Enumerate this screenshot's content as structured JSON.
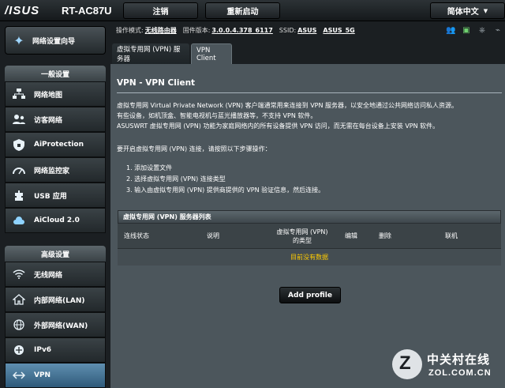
{
  "header": {
    "logo": "/ISUS",
    "model": "RT-AC87U",
    "logout_label": "注销",
    "reboot_label": "重新启动",
    "language": "简体中文"
  },
  "sidebar": {
    "quick_setup": "网络设置向导",
    "general_title": "一般设置",
    "general_items": [
      {
        "label": "网络地图",
        "icon": "network-map-icon"
      },
      {
        "label": "访客网络",
        "icon": "guest-network-icon"
      },
      {
        "label": "AiProtection",
        "icon": "aiprotection-icon"
      },
      {
        "label": "网络监控家",
        "icon": "traffic-monitor-icon"
      },
      {
        "label": "USB 应用",
        "icon": "usb-app-icon"
      },
      {
        "label": "AiCloud 2.0",
        "icon": "aicloud-icon"
      }
    ],
    "advanced_title": "高级设置",
    "advanced_items": [
      {
        "label": "无线网络",
        "icon": "wireless-icon"
      },
      {
        "label": "内部网络(LAN)",
        "icon": "lan-icon"
      },
      {
        "label": "外部网络(WAN)",
        "icon": "wan-icon"
      },
      {
        "label": "IPv6",
        "icon": "ipv6-icon"
      },
      {
        "label": "VPN",
        "icon": "vpn-icon",
        "active": true
      }
    ]
  },
  "status": {
    "mode_key": "操作模式:",
    "mode_value": "无线路由器",
    "firmware_key": "固件版本:",
    "firmware_value": "3.0.0.4.378_6117",
    "ssid_key": "SSID:",
    "ssid_1": "ASUS",
    "ssid_2": "ASUS_5G"
  },
  "tabs": {
    "server": "虚拟专用网 (VPN) 服务器",
    "client": "VPN Client"
  },
  "panel": {
    "title": "VPN - VPN Client",
    "desc_line1": "虚拟专用网 Virtual Private Network (VPN) 客户端通常用来连接到 VPN 服务器，以安全地通过公共网络访问私人资源。",
    "desc_line2": "有些设备，如机顶盒、智能电视机与蓝光播放器等，不支持 VPN 软件。",
    "desc_line3": "ASUSWRT 虚拟专用网 (VPN) 功能为家庭网络内的所有设备提供 VPN 访问，而无需在每台设备上安装 VPN 软件。",
    "steps_intro": "要开启虚拟专用网 (VPN) 连接，请按照以下步骤操作：",
    "step1": "1.  添加设置文件",
    "step2": "2.  选择虚拟专用网 (VPN) 连接类型",
    "step3": "3.  输入由虚拟专用网 (VPN) 提供商提供的 VPN 验证信息，然后连接。",
    "list_title": "虚拟专用网 (VPN) 服务器列表",
    "columns": {
      "status": "连线状态",
      "desc": "说明",
      "type_line1": "虚拟专用网 (VPN)",
      "type_line2": "的类型",
      "edit": "编辑",
      "delete": "删除",
      "connect": "联机"
    },
    "empty_text": "目前没有数据",
    "add_button": "Add profile"
  },
  "watermark": {
    "cn": "中关村在线",
    "en": "ZOL.COM.CN"
  }
}
